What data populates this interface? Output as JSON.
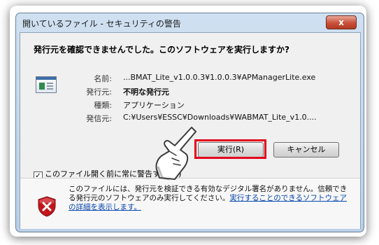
{
  "window": {
    "title": "開いているファイル - セキュリティの警告",
    "close_glyph": "x"
  },
  "heading": "発行元を確認できませんでした。このソフトウェアを実行しますか?",
  "file_info": {
    "name_label": "名前:",
    "name_value": "...BMAT_Lite_v1.0.0.3¥1.0.0.3¥APManagerLite.exe",
    "publisher_label": "発行元:",
    "publisher_value": "不明な発行元",
    "type_label": "種類:",
    "type_value": "アプリケーション",
    "source_label": "発信元:",
    "source_value": "C:¥Users¥ESSC¥Downloads¥WABMAT_Lite_v1.0...."
  },
  "buttons": {
    "run_label": "実行(R)",
    "cancel_label": "キャンセル"
  },
  "checkbox": {
    "label": "このファイル開く前に常に警告する(W)",
    "checked": true,
    "check_glyph": "✓"
  },
  "warning": {
    "text": "このファイルには、発行元を検証できる有効なデジタル署名がありません。信頼できる発行元のソフトウェアのみ実行してください。",
    "link": "実行することのできるソフトウェアの詳細を表示します。"
  },
  "icons": {
    "file_icon": "application-icon",
    "shield_icon": "shield-error-icon",
    "pointer": "pointing-hand-icon"
  },
  "colors": {
    "highlight": "#e3001b",
    "link": "#0645ad",
    "shield": "#c4161c"
  }
}
